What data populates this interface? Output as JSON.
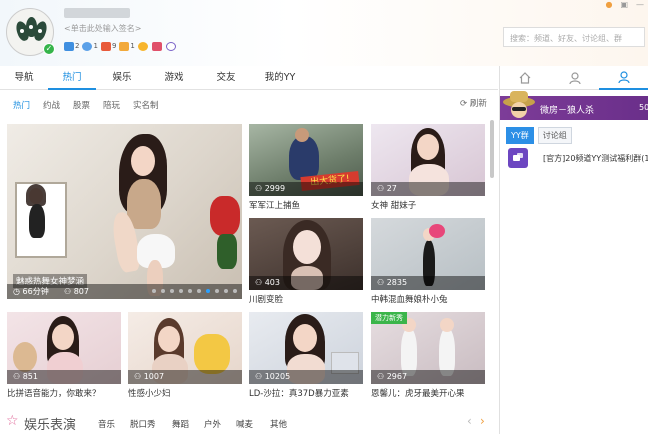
{
  "profile": {
    "signature_hint": "<单击此处输入签名>",
    "badge_counts": [
      "2",
      "1",
      "9",
      "1"
    ]
  },
  "search": {
    "placeholder": "搜索：频道、好友、讨论组、群"
  },
  "nav": {
    "tabs": [
      "导航",
      "热门",
      "娱乐",
      "游戏",
      "交友",
      "我的YY"
    ],
    "active": 1
  },
  "subnav": {
    "items": [
      "热门",
      "约战",
      "股票",
      "陪玩",
      "实名制"
    ],
    "active": 0,
    "refresh_label": "刷新"
  },
  "featured": {
    "tag": "魅惑热舞女神梦涵",
    "duration": "66分钟",
    "viewers": "807"
  },
  "tiles": [
    {
      "viewers": "2999",
      "caption": "军军江上捕鱼",
      "overlay_text": "出大货了!"
    },
    {
      "viewers": "27",
      "caption": "女神 甜妹子"
    },
    {
      "viewers": "403",
      "caption": "川剧变脸"
    },
    {
      "viewers": "2835",
      "caption": "中韩混血舞娘朴小兔"
    },
    {
      "viewers": "851",
      "caption": "比拼语音能力，你敢来？"
    },
    {
      "viewers": "1007",
      "caption": "性感小少妇"
    },
    {
      "viewers": "10205",
      "caption": "LD-沙拉：真37D暴力亚素"
    },
    {
      "viewers": "2967",
      "caption": "恩馨儿：虎牙最美开心果",
      "badge": "潜力新秀"
    }
  ],
  "section": {
    "title": "娱乐表演",
    "tabs": [
      "音乐",
      "脱口秀",
      "舞蹈",
      "户外",
      "喊麦",
      "其他"
    ]
  },
  "right_pane": {
    "banner_text": "微房－狼人杀",
    "banner_num": "50",
    "group_tabs": [
      "YY群",
      "讨论组"
    ],
    "group_item": "[官方]20频道YY测试福利群(1"
  },
  "colors": {
    "accent": "#1e8fe0",
    "banner": "#7d3c98",
    "group_icon": "#6c46c1"
  }
}
